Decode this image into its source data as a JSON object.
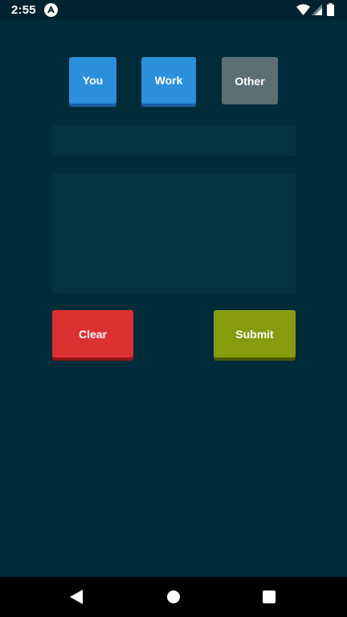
{
  "status_bar": {
    "time": "2:55",
    "icons": [
      "notification-a-icon",
      "wifi-icon",
      "signal-icon",
      "battery-icon"
    ]
  },
  "categories": {
    "items": [
      {
        "label": "You",
        "color": "#2b8fda",
        "selected": true
      },
      {
        "label": "Work",
        "color": "#2b8fda",
        "selected": true
      },
      {
        "label": "Other",
        "color": "#5b6e74",
        "selected": false
      }
    ]
  },
  "form": {
    "title_value": "",
    "body_value": ""
  },
  "actions": {
    "clear_label": "Clear",
    "clear_color": "#dc3131",
    "submit_label": "Submit",
    "submit_color": "#869c0c"
  },
  "nav_bar": {
    "icons": [
      "back-icon",
      "home-icon",
      "recents-icon"
    ]
  }
}
